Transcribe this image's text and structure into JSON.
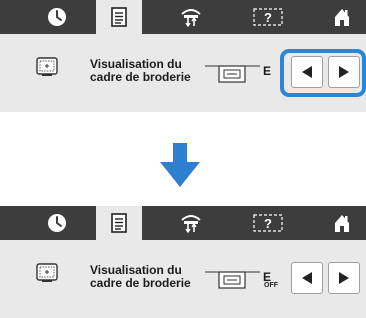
{
  "before": {
    "tabs": [
      "clock-icon",
      "document-icon",
      "thread-spool-icon",
      "help-icon",
      "home-icon"
    ],
    "setting_label": "Visualisation du cadre de broderie",
    "state_letter": "E",
    "state_off_text": "",
    "highlighted_buttons": true
  },
  "after": {
    "tabs": [
      "clock-icon",
      "document-icon",
      "thread-spool-icon",
      "help-icon",
      "home-icon"
    ],
    "setting_label": "Visualisation du cadre de broderie",
    "state_letter": "E",
    "state_off_text": "OFF",
    "highlighted_buttons": false
  },
  "colors": {
    "tab_bar": "#3d3d3d",
    "active_tab": "#e9e9e9",
    "row_background": "#e9e9e9",
    "highlight_border": "#2b87d6",
    "transition_arrow": "#2f7fd0"
  }
}
